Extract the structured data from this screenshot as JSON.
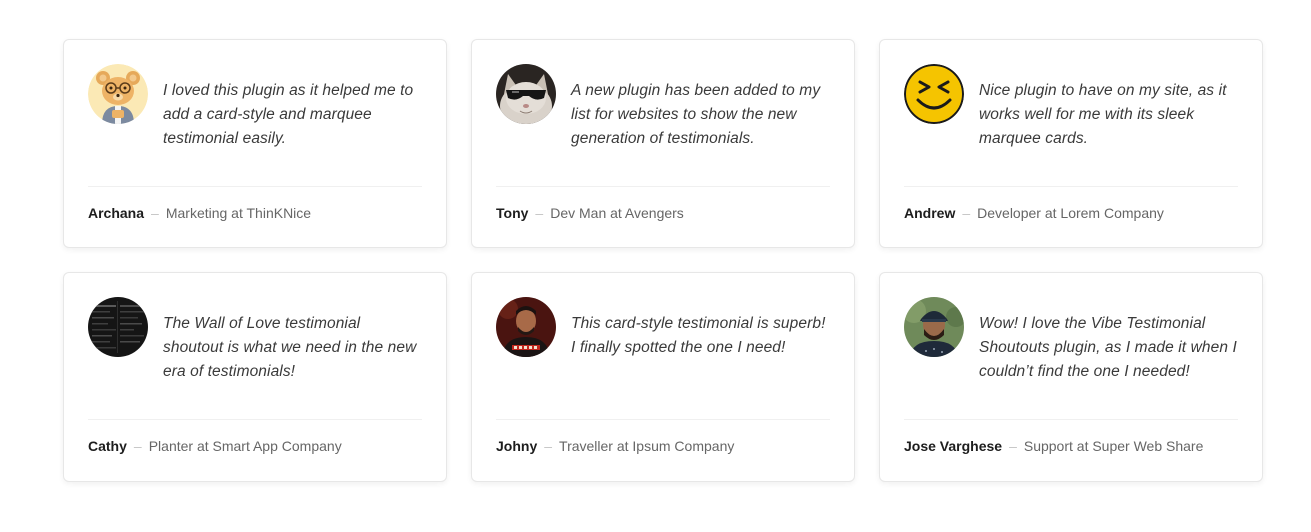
{
  "testimonials": [
    {
      "quote": "I loved this plugin as it helped me to add a card-style and marquee testimonial easily.",
      "name": "Archana",
      "separator": "–",
      "role": "Marketing at ThinKNice",
      "avatar": "teddy-bear-avatar"
    },
    {
      "quote": "A new plugin has been added to my list for websites to show the new generation of testimonials.",
      "name": "Tony",
      "separator": "–",
      "role": "Dev Man at Avengers",
      "avatar": "cat-sunglasses-avatar"
    },
    {
      "quote": "Nice plugin to have on my site, as it works well for me with its sleek marquee cards.",
      "name": "Andrew",
      "separator": "–",
      "role": "Developer at Lorem Company",
      "avatar": "smiley-face-avatar"
    },
    {
      "quote": "The Wall of Love testimonial shoutout is what we need in the new era of testimonials!",
      "name": "Cathy",
      "separator": "–",
      "role": "Planter at Smart App Company",
      "avatar": "dark-screen-avatar"
    },
    {
      "quote": "This card-style testimonial is superb! I finally spotted the one I need!",
      "name": "Johny",
      "separator": "–",
      "role": "Traveller at Ipsum Company",
      "avatar": "man-portrait-avatar"
    },
    {
      "quote": "Wow! I love the Vibe Testimonial Shoutouts plugin, as I made it when I couldn’t find the one I needed!",
      "name": "Jose Varghese",
      "separator": "–",
      "role": "Support at Super Web Share",
      "avatar": "man-cap-avatar"
    }
  ],
  "colors": {
    "card_border": "#e7e7e7",
    "quote_text": "#3a3a3a",
    "name_text": "#1d1d1d",
    "role_text": "#666666",
    "smiley_yellow": "#f5c400"
  }
}
